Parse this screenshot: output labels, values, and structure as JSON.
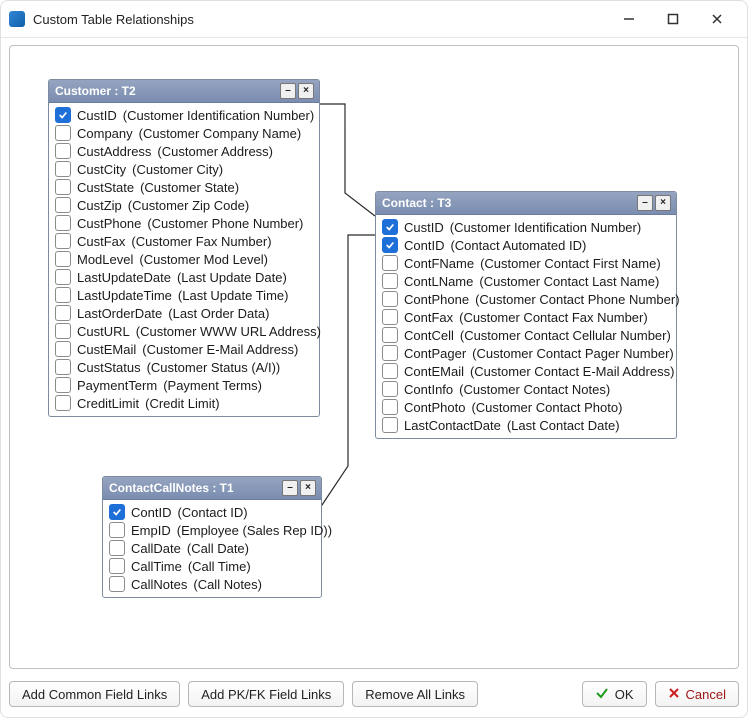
{
  "window": {
    "title": "Custom Table Relationships"
  },
  "tables": {
    "customer": {
      "title": "Customer : T2",
      "fields": [
        {
          "name": "CustID",
          "desc": "(Customer Identification Number)",
          "checked": true
        },
        {
          "name": "Company",
          "desc": "(Customer Company Name)",
          "checked": false
        },
        {
          "name": "CustAddress",
          "desc": "(Customer Address)",
          "checked": false
        },
        {
          "name": "CustCity",
          "desc": "(Customer City)",
          "checked": false
        },
        {
          "name": "CustState",
          "desc": "(Customer State)",
          "checked": false
        },
        {
          "name": "CustZip",
          "desc": "(Customer Zip Code)",
          "checked": false
        },
        {
          "name": "CustPhone",
          "desc": "(Customer Phone Number)",
          "checked": false
        },
        {
          "name": "CustFax",
          "desc": "(Customer Fax Number)",
          "checked": false
        },
        {
          "name": "ModLevel",
          "desc": "(Customer Mod Level)",
          "checked": false
        },
        {
          "name": "LastUpdateDate",
          "desc": "(Last Update Date)",
          "checked": false
        },
        {
          "name": "LastUpdateTime",
          "desc": "(Last Update Time)",
          "checked": false
        },
        {
          "name": "LastOrderDate",
          "desc": "(Last Order Data)",
          "checked": false
        },
        {
          "name": "CustURL",
          "desc": "(Customer WWW URL Address)",
          "checked": false
        },
        {
          "name": "CustEMail",
          "desc": "(Customer E-Mail Address)",
          "checked": false
        },
        {
          "name": "CustStatus",
          "desc": "(Customer Status (A/I))",
          "checked": false
        },
        {
          "name": "PaymentTerm",
          "desc": "(Payment Terms)",
          "checked": false
        },
        {
          "name": "CreditLimit",
          "desc": "(Credit Limit)",
          "checked": false
        }
      ]
    },
    "contact": {
      "title": "Contact : T3",
      "fields": [
        {
          "name": "CustID",
          "desc": "(Customer Identification Number)",
          "checked": true
        },
        {
          "name": "ContID",
          "desc": "(Contact Automated ID)",
          "checked": true
        },
        {
          "name": "ContFName",
          "desc": "(Customer Contact First Name)",
          "checked": false
        },
        {
          "name": "ContLName",
          "desc": "(Customer Contact Last Name)",
          "checked": false
        },
        {
          "name": "ContPhone",
          "desc": "(Customer Contact Phone Number)",
          "checked": false
        },
        {
          "name": "ContFax",
          "desc": "(Customer Contact Fax Number)",
          "checked": false
        },
        {
          "name": "ContCell",
          "desc": "(Customer Contact Cellular Number)",
          "checked": false
        },
        {
          "name": "ContPager",
          "desc": "(Customer Contact Pager Number)",
          "checked": false
        },
        {
          "name": "ContEMail",
          "desc": "(Customer Contact E-Mail Address)",
          "checked": false
        },
        {
          "name": "ContInfo",
          "desc": "(Customer Contact Notes)",
          "checked": false
        },
        {
          "name": "ContPhoto",
          "desc": "(Customer Contact Photo)",
          "checked": false
        },
        {
          "name": "LastContactDate",
          "desc": "(Last Contact Date)",
          "checked": false
        }
      ]
    },
    "callnotes": {
      "title": "ContactCallNotes : T1",
      "fields": [
        {
          "name": "ContID",
          "desc": "(Contact ID)",
          "checked": true
        },
        {
          "name": "EmpID",
          "desc": "(Employee (Sales Rep ID))",
          "checked": false
        },
        {
          "name": "CallDate",
          "desc": "(Call Date)",
          "checked": false
        },
        {
          "name": "CallTime",
          "desc": "(Call Time)",
          "checked": false
        },
        {
          "name": "CallNotes",
          "desc": "(Call Notes)",
          "checked": false
        }
      ]
    }
  },
  "buttons": {
    "addCommon": "Add Common Field Links",
    "addPkFk": "Add PK/FK Field Links",
    "removeAll": "Remove All Links",
    "ok": "OK",
    "cancel": "Cancel"
  }
}
